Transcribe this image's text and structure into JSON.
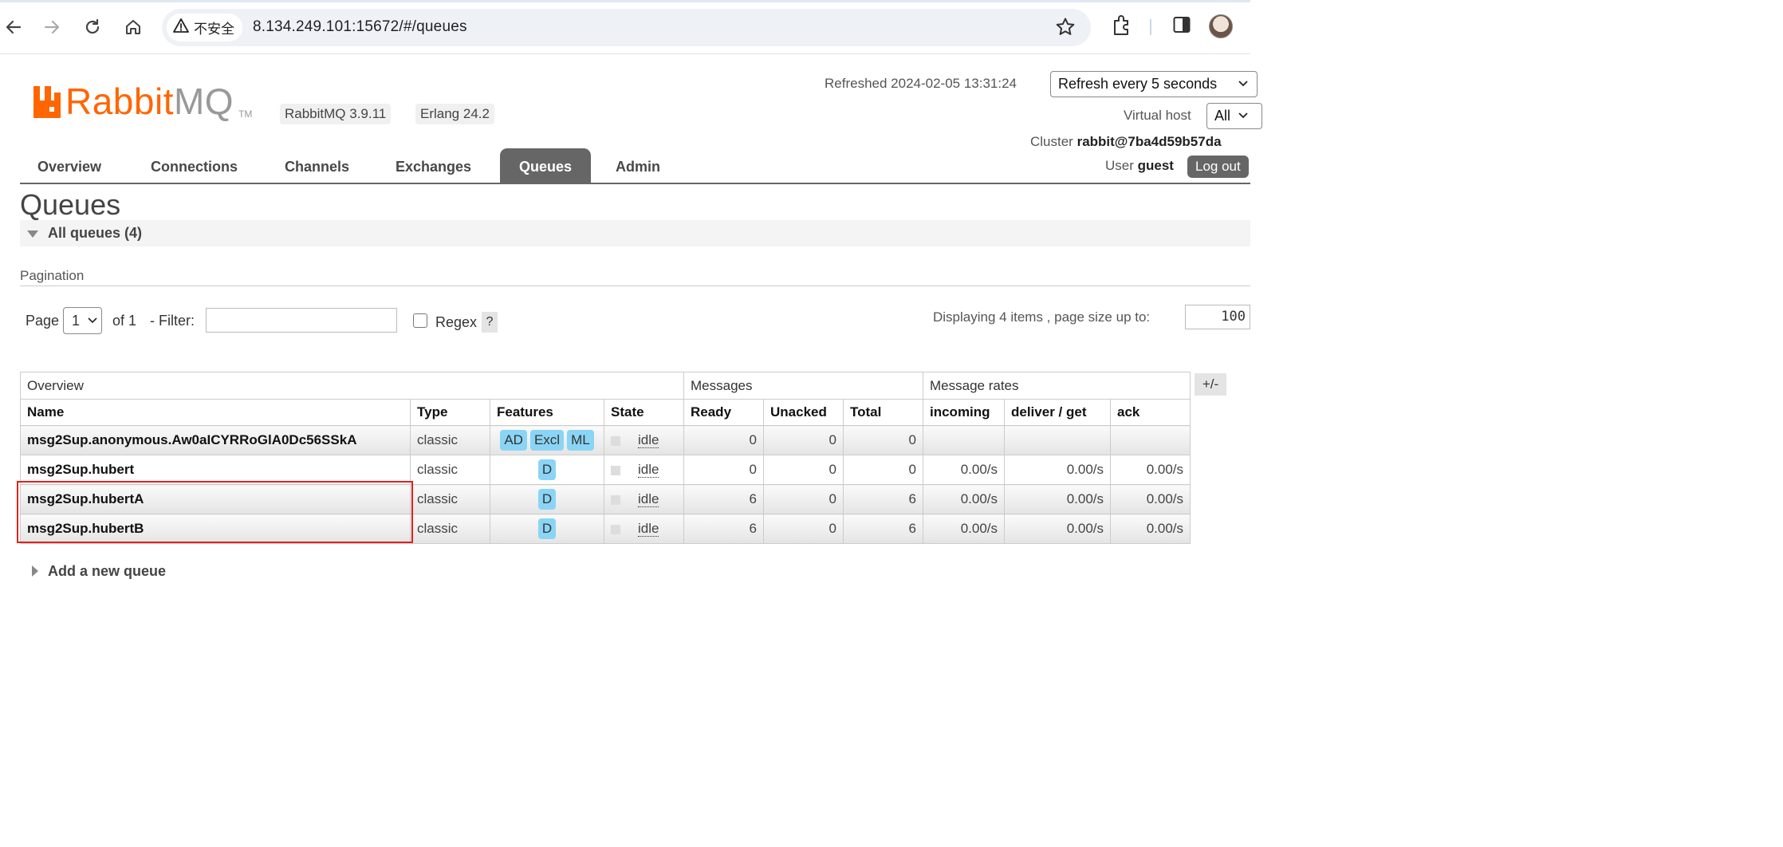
{
  "browser": {
    "security_label": "不安全",
    "url": "8.134.249.101:15672/#/queues"
  },
  "header": {
    "logo_rabbit": "Rabbit",
    "logo_mq": "MQ",
    "logo_tm": "TM",
    "rabbitmq_version": "RabbitMQ 3.9.11",
    "erlang_version": "Erlang 24.2",
    "refreshed_label": "Refreshed 2024-02-05 13:31:24",
    "refresh_interval": "Refresh every 5 seconds",
    "vhost_label": "Virtual host",
    "vhost_value": "All",
    "cluster_label": "Cluster ",
    "cluster_name": "rabbit@7ba4d59b57da",
    "user_label": "User ",
    "user_name": "guest",
    "logout_label": "Log out"
  },
  "tabs": [
    "Overview",
    "Connections",
    "Channels",
    "Exchanges",
    "Queues",
    "Admin"
  ],
  "active_tab": "Queues",
  "page": {
    "title": "Queues",
    "section_title": "All queues (4)",
    "pagination_heading": "Pagination",
    "page_label": "Page",
    "page_value": "1",
    "of_label": "of 1",
    "filter_label": "- Filter:",
    "filter_value": "",
    "regex_label": "Regex",
    "help_label": "?",
    "displaying_text": "Displaying 4 items , page size up to:",
    "page_size": "100",
    "plus_minus": "+/-",
    "add_queue": "Add a new queue"
  },
  "table": {
    "groups": [
      "Overview",
      "Messages",
      "Message rates"
    ],
    "columns": [
      "Name",
      "Type",
      "Features",
      "State",
      "Ready",
      "Unacked",
      "Total",
      "incoming",
      "deliver / get",
      "ack"
    ],
    "rows": [
      {
        "name": "msg2Sup.anonymous.Aw0aICYRRoGlA0Dc56SSkA",
        "type": "classic",
        "features": [
          "AD",
          "Excl",
          "ML"
        ],
        "state": "idle",
        "ready": "0",
        "unacked": "0",
        "total": "0",
        "incoming": "",
        "deliver_get": "",
        "ack": ""
      },
      {
        "name": "msg2Sup.hubert",
        "type": "classic",
        "features": [
          "D"
        ],
        "state": "idle",
        "ready": "0",
        "unacked": "0",
        "total": "0",
        "incoming": "0.00/s",
        "deliver_get": "0.00/s",
        "ack": "0.00/s"
      },
      {
        "name": "msg2Sup.hubertA",
        "type": "classic",
        "features": [
          "D"
        ],
        "state": "idle",
        "ready": "6",
        "unacked": "0",
        "total": "6",
        "incoming": "0.00/s",
        "deliver_get": "0.00/s",
        "ack": "0.00/s"
      },
      {
        "name": "msg2Sup.hubertB",
        "type": "classic",
        "features": [
          "D"
        ],
        "state": "idle",
        "ready": "6",
        "unacked": "0",
        "total": "6",
        "incoming": "0.00/s",
        "deliver_get": "0.00/s",
        "ack": "0.00/s"
      }
    ]
  },
  "colors": {
    "brand": "#ff6600",
    "feature_badge": "#8ad5f5",
    "highlight_box": "#e0221c"
  }
}
